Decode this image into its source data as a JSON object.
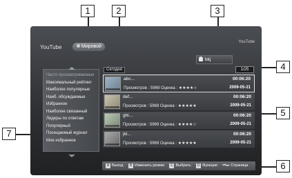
{
  "callouts": [
    "1",
    "2",
    "3",
    "4",
    "5",
    "6",
    "7"
  ],
  "header": {
    "app_name": "YouTube",
    "region_tab": "Мировой",
    "logo_text": "YouTube"
  },
  "user": {
    "name": "bkj"
  },
  "list": {
    "label": "Сегодня",
    "page": "1/25"
  },
  "categories": [
    {
      "label": "Часто просматриваемые",
      "selected": true
    },
    {
      "label": "Максимальный рейтинг"
    },
    {
      "label": "Наиболее популярные"
    },
    {
      "label": "Наиб. обсуждаемые"
    },
    {
      "label": "Избранное"
    },
    {
      "label": "Наиболее связанный"
    },
    {
      "label": "Лидеры по ответам"
    },
    {
      "label": "Популярный"
    },
    {
      "label": "Посещаемый журнал"
    },
    {
      "label": "Мое избранное"
    }
  ],
  "videos": [
    {
      "title": "abc...",
      "duration": "00:06:20",
      "meta": "Просмотров : 5969 Оценка : ★★★★☆",
      "date": "2009-05-21",
      "rating": 4
    },
    {
      "title": "def...",
      "duration": "00:06:20",
      "meta": "Просмотров : 5969 Оценка : ★★★★★",
      "date": "2009-05-21",
      "rating": 5
    },
    {
      "title": "ghi...",
      "duration": "00:06:20",
      "meta": "Просмотров : 5969 Оценка : ★★★★☆",
      "date": "2009-05-21",
      "rating": 4
    },
    {
      "title": "jkl...",
      "duration": "00:06:20",
      "meta": "Просмотров : 5969 Оценка : ★★★★★",
      "date": "2009-05-21",
      "rating": 5
    }
  ],
  "help": [
    {
      "key": "A",
      "label": "Выход"
    },
    {
      "key": "B",
      "label": "Изменить режим"
    },
    {
      "key": "C",
      "label": "Выбрать"
    },
    {
      "key": "D",
      "label": "Функции"
    },
    {
      "key": "⏮⏭",
      "label": "Страница"
    }
  ],
  "colors": {
    "screen_bg": "#2f3134",
    "sidebar_bg": "#595c61",
    "text": "#ffffff",
    "callout_border": "#222222"
  }
}
